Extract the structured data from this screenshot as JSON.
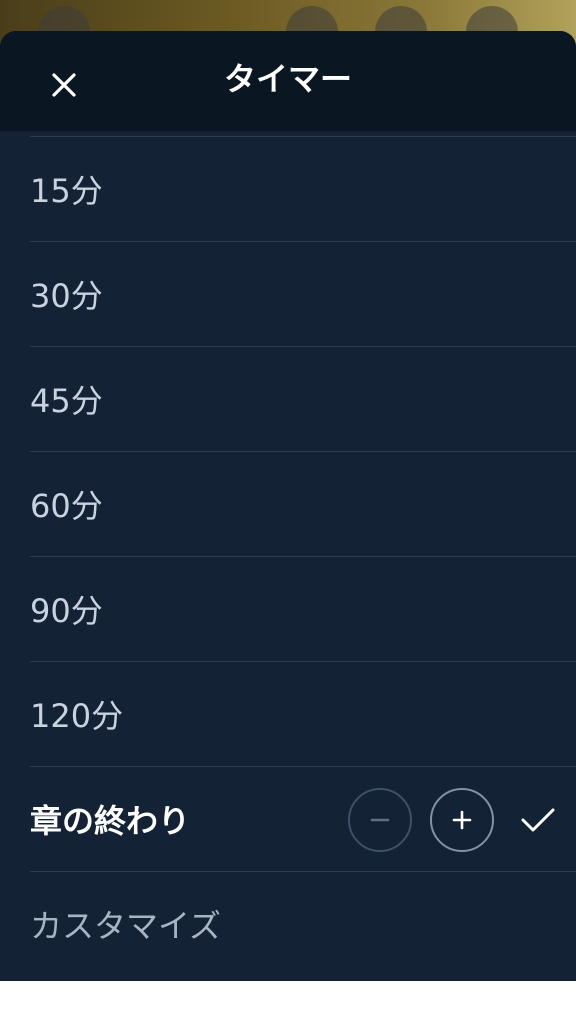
{
  "header": {
    "title": "タイマー",
    "close_icon": "close-icon"
  },
  "options": [
    {
      "label": "15分"
    },
    {
      "label": "30分"
    },
    {
      "label": "45分"
    },
    {
      "label": "60分"
    },
    {
      "label": "90分"
    },
    {
      "label": "120分"
    },
    {
      "label": "章の終わり",
      "active": true
    },
    {
      "label": "カスタマイズ"
    }
  ],
  "end_of_chapter_controls": {
    "decrease_icon": "minus-icon",
    "increase_icon": "plus-icon",
    "selected_icon": "checkmark-icon"
  },
  "colors": {
    "sheet_background": "#132235",
    "header_background": "#0a1622",
    "divider": "#2b3c52",
    "text": "#c9d3df"
  }
}
